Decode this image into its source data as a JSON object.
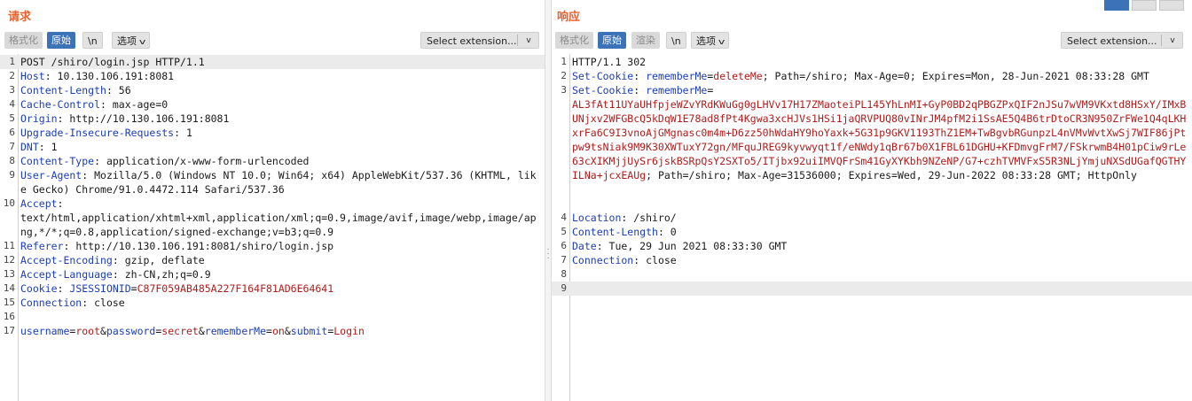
{
  "request": {
    "title": "请求",
    "buttons": {
      "pretty": "格式化",
      "raw": "原始",
      "newline": "\\n",
      "options": "选项"
    },
    "extension": "Select extension...",
    "lines": [
      {
        "n": "1",
        "parts": [
          {
            "t": "POST /shiro/login.jsp HTTP/1.1",
            "c": "val"
          }
        ]
      },
      {
        "n": "2",
        "parts": [
          {
            "t": "Host",
            "c": "hdr"
          },
          {
            "t": ": 10.130.106.191:8081",
            "c": "val"
          }
        ]
      },
      {
        "n": "3",
        "parts": [
          {
            "t": "Content-Length",
            "c": "hdr"
          },
          {
            "t": ": 56",
            "c": "val"
          }
        ]
      },
      {
        "n": "4",
        "parts": [
          {
            "t": "Cache-Control",
            "c": "hdr"
          },
          {
            "t": ": max-age=0",
            "c": "val"
          }
        ]
      },
      {
        "n": "5",
        "parts": [
          {
            "t": "Origin",
            "c": "hdr"
          },
          {
            "t": ": http://10.130.106.191:8081",
            "c": "val"
          }
        ]
      },
      {
        "n": "6",
        "parts": [
          {
            "t": "Upgrade-Insecure-Requests",
            "c": "hdr"
          },
          {
            "t": ": 1",
            "c": "val"
          }
        ]
      },
      {
        "n": "7",
        "parts": [
          {
            "t": "DNT",
            "c": "hdr"
          },
          {
            "t": ": 1",
            "c": "val"
          }
        ]
      },
      {
        "n": "8",
        "parts": [
          {
            "t": "Content-Type",
            "c": "hdr"
          },
          {
            "t": ": application/x-www-form-urlencoded",
            "c": "val"
          }
        ]
      },
      {
        "n": "9",
        "parts": [
          {
            "t": "User-Agent",
            "c": "hdr"
          },
          {
            "t": ": Mozilla/5.0 (Windows NT 10.0; Win64; x64) AppleWebKit/537.36 (KHTML, like Gecko) Chrome/91.0.4472.114 Safari/537.36",
            "c": "val"
          }
        ]
      },
      {
        "n": "10",
        "parts": [
          {
            "t": "Accept",
            "c": "hdr"
          },
          {
            "t": ":\ntext/html,application/xhtml+xml,application/xml;q=0.9,image/avif,image/webp,image/apng,*/*;q=0.8,application/signed-exchange;v=b3;q=0.9",
            "c": "val"
          }
        ]
      },
      {
        "n": "11",
        "parts": [
          {
            "t": "Referer",
            "c": "hdr"
          },
          {
            "t": ": http://10.130.106.191:8081/shiro/login.jsp",
            "c": "val"
          }
        ]
      },
      {
        "n": "12",
        "parts": [
          {
            "t": "Accept-Encoding",
            "c": "hdr"
          },
          {
            "t": ": gzip, deflate",
            "c": "val"
          }
        ]
      },
      {
        "n": "13",
        "parts": [
          {
            "t": "Accept-Language",
            "c": "hdr"
          },
          {
            "t": ": zh-CN,zh;q=0.9",
            "c": "val"
          }
        ]
      },
      {
        "n": "14",
        "parts": [
          {
            "t": "Cookie",
            "c": "hdr"
          },
          {
            "t": ": ",
            "c": "val"
          },
          {
            "t": "JSESSIONID",
            "c": "hdr"
          },
          {
            "t": "=",
            "c": "val"
          },
          {
            "t": "C87F059AB485A227F164F81AD6E64641",
            "c": "red"
          }
        ]
      },
      {
        "n": "15",
        "parts": [
          {
            "t": "Connection",
            "c": "hdr"
          },
          {
            "t": ": close",
            "c": "val"
          }
        ]
      },
      {
        "n": "16",
        "parts": []
      },
      {
        "n": "17",
        "parts": [
          {
            "t": "username",
            "c": "hdr"
          },
          {
            "t": "=",
            "c": "val"
          },
          {
            "t": "root",
            "c": "red"
          },
          {
            "t": "&",
            "c": "val"
          },
          {
            "t": "password",
            "c": "hdr"
          },
          {
            "t": "=",
            "c": "val"
          },
          {
            "t": "secret",
            "c": "red"
          },
          {
            "t": "&",
            "c": "val"
          },
          {
            "t": "rememberMe",
            "c": "hdr"
          },
          {
            "t": "=",
            "c": "val"
          },
          {
            "t": "on",
            "c": "red"
          },
          {
            "t": "&",
            "c": "val"
          },
          {
            "t": "submit",
            "c": "hdr"
          },
          {
            "t": "=",
            "c": "val"
          },
          {
            "t": "Login",
            "c": "red"
          }
        ]
      }
    ]
  },
  "response": {
    "title": "响应",
    "buttons": {
      "pretty": "格式化",
      "raw": "原始",
      "render": "渲染",
      "newline": "\\n",
      "options": "选项"
    },
    "extension": "Select extension...",
    "lines": [
      {
        "n": "1",
        "parts": [
          {
            "t": "HTTP/1.1 302",
            "c": "val"
          }
        ]
      },
      {
        "n": "2",
        "parts": [
          {
            "t": "Set-Cookie",
            "c": "hdr"
          },
          {
            "t": ": ",
            "c": "val"
          },
          {
            "t": "rememberMe",
            "c": "hdr"
          },
          {
            "t": "=",
            "c": "val"
          },
          {
            "t": "deleteMe",
            "c": "red"
          },
          {
            "t": "; Path=/shiro; Max-Age=0; Expires=Mon, 28-Jun-2021 08:33:28 GMT",
            "c": "val"
          }
        ]
      },
      {
        "n": "3",
        "parts": [
          {
            "t": "Set-Cookie",
            "c": "hdr"
          },
          {
            "t": ": ",
            "c": "val"
          },
          {
            "t": "rememberMe",
            "c": "hdr"
          },
          {
            "t": "=\n",
            "c": "val"
          },
          {
            "t": "AL3fAt11UYaUHfpjeWZvYRdKWuGg0gLHVv17H17ZMaoteiPL145YhLnMI+GyP0BD2qPBGZPxQIF2nJSu7wVM9VKxtd8HSxY/IMxBUNjxv2WFGBcQ5kDqW1E78ad8fPt4Kgwa3xcHJVs1HSi1jaQRVPUQ80vINrJM4pfM2i1SsAE5Q4B6trDtoCR3N950ZrFWe1Q4qLKHxrFa6C9I3vnoAjGMgnasc0m4m+D6zz50hWdaHY9hoYaxk+5G31p9GKV1193ThZ1EM+TwBgvbRGunpzL4nVMvWvtXwSj7WIF86jPtpw9tsNiak9M9K30XWTuxY72gn/MFquJREG9kyvwyqt1f/eNWdy1qBr67b0X1FBL61DGHU+KFDmvgFrM7/FSkrwmB4H01pCiw9rLe63cXIKMjjUySr6jskBSRpQsY2SXTo5/ITjbx92uiIMVQFrSm41GyXYKbh9NZeNP/G7+czhTVMVFxS5R3NLjYmjuNXSdUGafQGTHYILNa+jcxEAUg",
            "c": "red"
          },
          {
            "t": "; Path=/shiro; Max-Age=31536000; Expires=Wed, 29-Jun-2022 08:33:28 GMT; HttpOnly",
            "c": "val"
          }
        ]
      },
      {
        "n": "4",
        "parts": [
          {
            "t": "Location",
            "c": "hdr"
          },
          {
            "t": ": /shiro/",
            "c": "val"
          }
        ]
      },
      {
        "n": "5",
        "parts": [
          {
            "t": "Content-Length",
            "c": "hdr"
          },
          {
            "t": ": 0",
            "c": "val"
          }
        ]
      },
      {
        "n": "6",
        "parts": [
          {
            "t": "Date",
            "c": "hdr"
          },
          {
            "t": ": Tue, 29 Jun 2021 08:33:30 GMT",
            "c": "val"
          }
        ]
      },
      {
        "n": "7",
        "parts": [
          {
            "t": "Connection",
            "c": "hdr"
          },
          {
            "t": ": close",
            "c": "val"
          }
        ]
      },
      {
        "n": "8",
        "parts": []
      },
      {
        "n": "9",
        "parts": []
      }
    ]
  }
}
